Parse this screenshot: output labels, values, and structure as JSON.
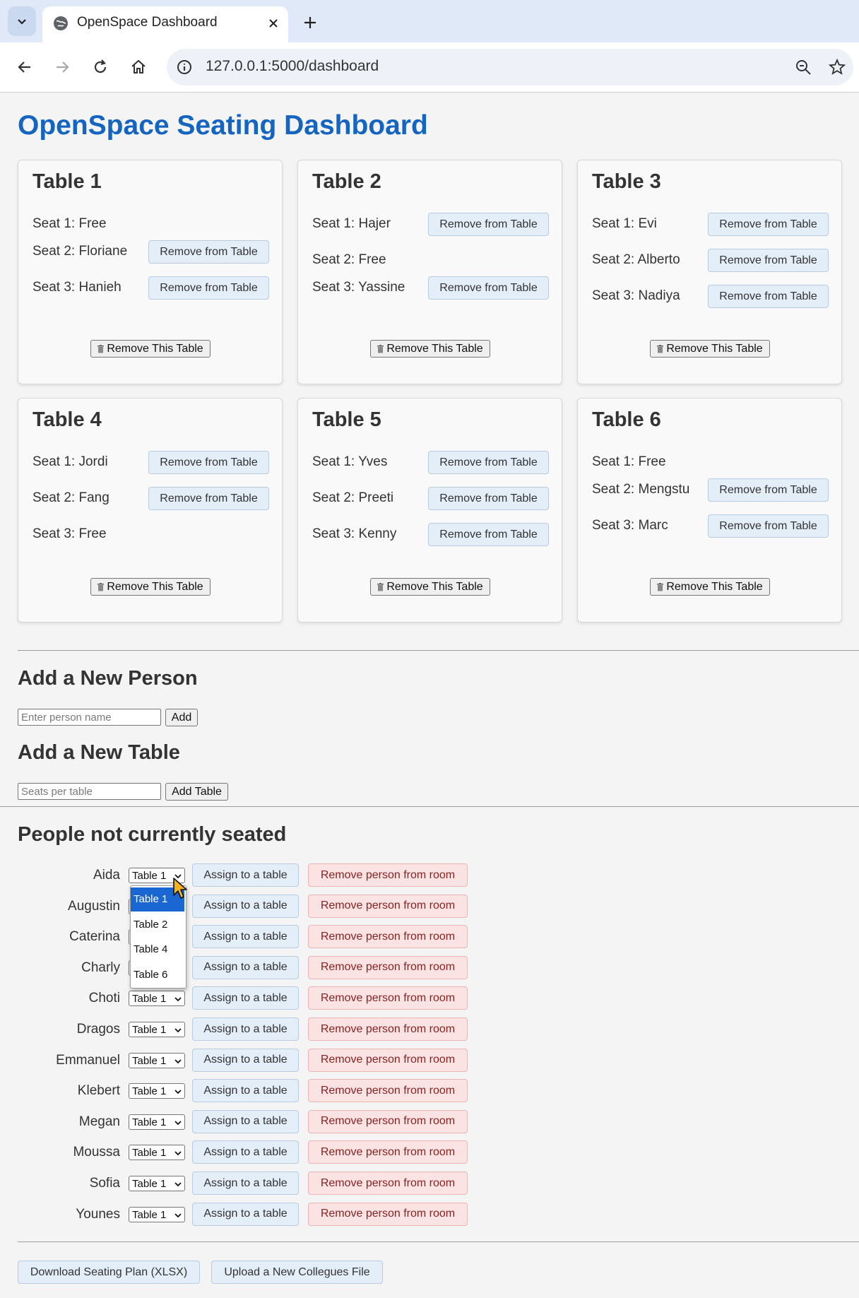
{
  "browser": {
    "tab_title": "OpenSpace Dashboard",
    "url": "127.0.0.1:5000/dashboard"
  },
  "page": {
    "title": "OpenSpace Seating Dashboard",
    "remove_seat_label": "Remove from Table",
    "remove_table_label": "Remove This Table",
    "tables": [
      {
        "name": "Table 1",
        "seats": [
          {
            "label": "Seat 1: Free",
            "occupied": false
          },
          {
            "label": "Seat 2: Floriane",
            "occupied": true
          },
          {
            "label": "Seat 3: Hanieh",
            "occupied": true
          }
        ]
      },
      {
        "name": "Table 2",
        "seats": [
          {
            "label": "Seat 1: Hajer",
            "occupied": true
          },
          {
            "label": "Seat 2: Free",
            "occupied": false
          },
          {
            "label": "Seat 3: Yassine",
            "occupied": true
          }
        ]
      },
      {
        "name": "Table 3",
        "seats": [
          {
            "label": "Seat 1: Evi",
            "occupied": true
          },
          {
            "label": "Seat 2: Alberto",
            "occupied": true
          },
          {
            "label": "Seat 3: Nadiya",
            "occupied": true
          }
        ]
      },
      {
        "name": "Table 4",
        "seats": [
          {
            "label": "Seat 1: Jordi",
            "occupied": true
          },
          {
            "label": "Seat 2: Fang",
            "occupied": true
          },
          {
            "label": "Seat 3: Free",
            "occupied": false
          }
        ]
      },
      {
        "name": "Table 5",
        "seats": [
          {
            "label": "Seat 1: Yves",
            "occupied": true
          },
          {
            "label": "Seat 2: Preeti",
            "occupied": true
          },
          {
            "label": "Seat 3: Kenny",
            "occupied": true
          }
        ]
      },
      {
        "name": "Table 6",
        "seats": [
          {
            "label": "Seat 1: Free",
            "occupied": false
          },
          {
            "label": "Seat 2: Mengstu",
            "occupied": true
          },
          {
            "label": "Seat 3: Marc",
            "occupied": true
          }
        ]
      }
    ],
    "add_person": {
      "title": "Add a New Person",
      "placeholder": "Enter person name",
      "button": "Add"
    },
    "add_table": {
      "title": "Add a New Table",
      "placeholder": "Seats per table",
      "button": "Add Table"
    },
    "unseated": {
      "title": "People not currently seated",
      "assign_label": "Assign to a table",
      "remove_label": "Remove person from room",
      "people": [
        {
          "name": "Aida",
          "selected": "Table 1"
        },
        {
          "name": "Augustin",
          "selected": "Table 1"
        },
        {
          "name": "Caterina",
          "selected": "Table 1"
        },
        {
          "name": "Charly",
          "selected": "Table 1"
        },
        {
          "name": "Choti",
          "selected": "Table 1"
        },
        {
          "name": "Dragos",
          "selected": "Table 1"
        },
        {
          "name": "Emmanuel",
          "selected": "Table 1"
        },
        {
          "name": "Klebert",
          "selected": "Table 1"
        },
        {
          "name": "Megan",
          "selected": "Table 1"
        },
        {
          "name": "Moussa",
          "selected": "Table 1"
        },
        {
          "name": "Sofia",
          "selected": "Table 1"
        },
        {
          "name": "Younes",
          "selected": "Table 1"
        }
      ],
      "open_dropdown_options": [
        "Table 1",
        "Table 2",
        "Table 4",
        "Table 6"
      ],
      "open_dropdown_selected": "Table 1"
    },
    "footer": {
      "download_label": "Download Seating Plan (XLSX)",
      "upload_label": "Upload a New Collegues File"
    }
  },
  "colors": {
    "title_blue": "#1565c0",
    "assign_button_bg": "#e4eef9",
    "remove_person_bg": "#fbe3e3",
    "dropdown_highlight": "#1a66d2"
  }
}
